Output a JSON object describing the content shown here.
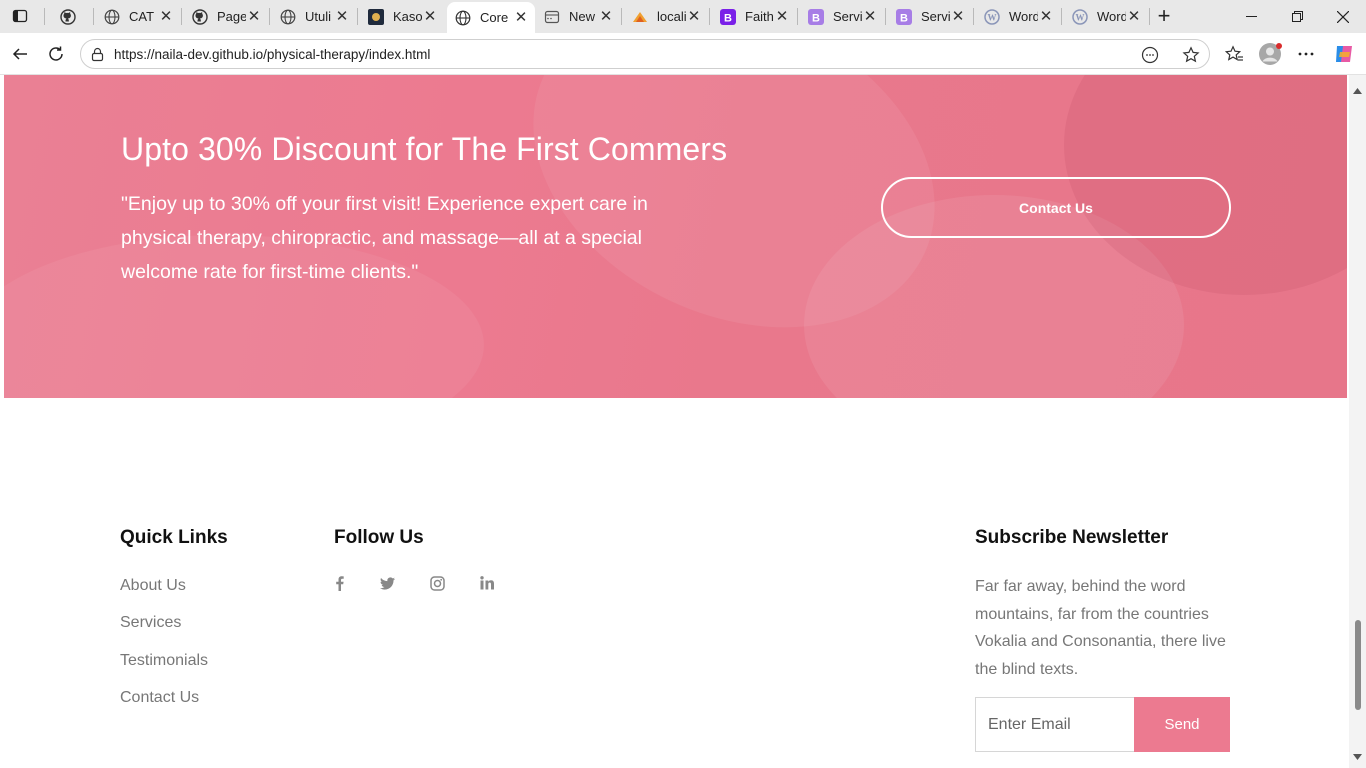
{
  "browser": {
    "tabs": [
      {
        "title": "",
        "icon": "github-icon"
      },
      {
        "title": "CAT",
        "icon": "globe-icon"
      },
      {
        "title": "Page",
        "icon": "github-icon"
      },
      {
        "title": "Utuli",
        "icon": "globe-icon"
      },
      {
        "title": "Kaso",
        "icon": "kaso-icon"
      },
      {
        "title": "Core",
        "icon": "globe-icon",
        "active": true
      },
      {
        "title": "New",
        "icon": "newtab-icon"
      },
      {
        "title": "locali",
        "icon": "phpmyadmin-icon"
      },
      {
        "title": "Faith",
        "icon": "bootstrap-icon"
      },
      {
        "title": "Servi",
        "icon": "bootstrap-icon"
      },
      {
        "title": "Servi",
        "icon": "bootstrap-icon"
      },
      {
        "title": "Word",
        "icon": "wordpress-icon"
      },
      {
        "title": "Word",
        "icon": "wordpress-icon"
      }
    ],
    "url": "https://naila-dev.github.io/physical-therapy/index.html"
  },
  "promo": {
    "title": "Upto 30% Discount for The First Commers",
    "text": "\"Enjoy up to 30% off your first visit! Experience expert care in physical therapy, chiropractic, and massage—all at a special welcome rate for first-time clients.\"",
    "button": "Contact Us",
    "accent": "#ec7a90"
  },
  "footer": {
    "quick_links_title": "Quick Links",
    "quick_links": [
      "About Us",
      "Services",
      "Testimonials",
      "Contact Us"
    ],
    "follow_title": "Follow Us",
    "social": [
      "facebook-icon",
      "twitter-icon",
      "instagram-icon",
      "linkedin-icon"
    ],
    "newsletter_title": "Subscribe Newsletter",
    "newsletter_text": "Far far away, behind the word mountains, far from the countries Vokalia and Consonantia, there live the blind texts.",
    "email_placeholder": "Enter Email",
    "send_label": "Send"
  }
}
